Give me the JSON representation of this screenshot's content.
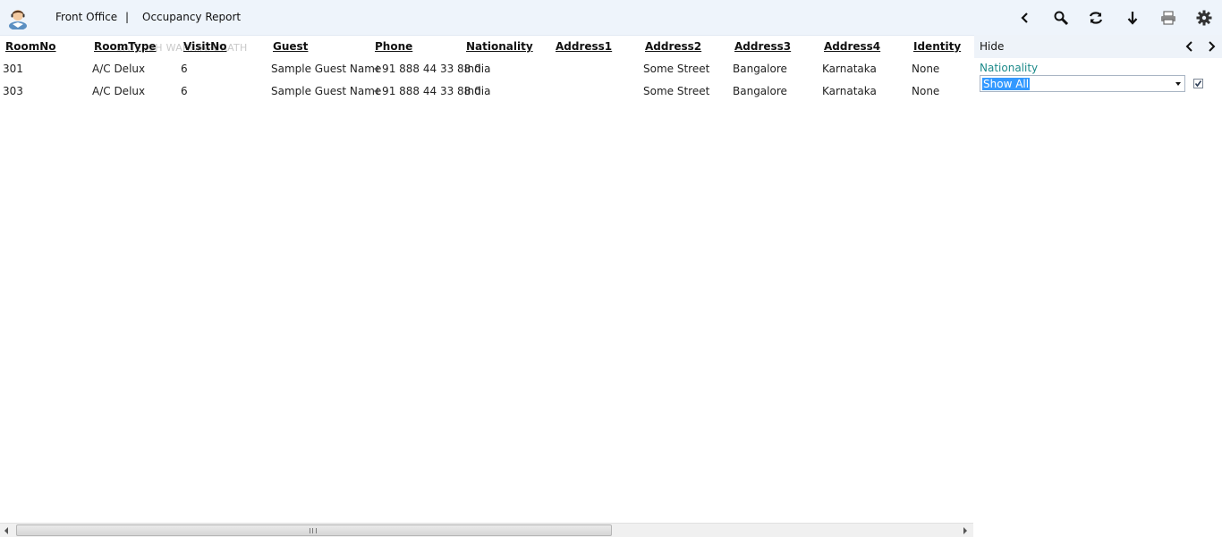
{
  "header": {
    "module": "Front Office",
    "separator": "|",
    "report": "Occupancy Report",
    "tools": [
      "back-icon",
      "search-icon",
      "refresh-icon",
      "download-icon",
      "print-icon",
      "gear-icon"
    ]
  },
  "grid": {
    "watermark": "SATEESH WARRIAPURATH",
    "columns": [
      "RoomNo",
      "RoomType",
      "VisitNo",
      "Guest",
      "Phone",
      "Nationality",
      "Address1",
      "Address2",
      "Address3",
      "Address4",
      "Identity"
    ],
    "rows": [
      [
        "301",
        "A/C Delux",
        "6",
        "Sample Guest Name",
        "+91 888 44 33 88 0",
        "India",
        "",
        "Some Street",
        "Bangalore",
        "Karnataka",
        "None"
      ],
      [
        "303",
        "A/C Delux",
        "6",
        "Sample Guest Name",
        "+91 888 44 33 88 0",
        "India",
        "",
        "Some Street",
        "Bangalore",
        "Karnataka",
        "None"
      ]
    ]
  },
  "panel": {
    "hide_label": "Hide",
    "filter_label": "Nationality",
    "filter_value": "Show All",
    "filter_checked": true
  },
  "colors": {
    "header_bg": "#eef4fb",
    "filter_label": "#1c8a8a",
    "selection": "#3399ff"
  }
}
